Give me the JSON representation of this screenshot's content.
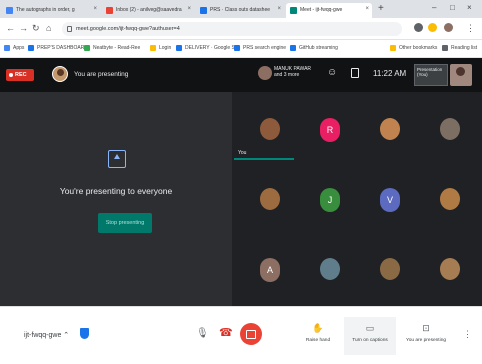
{
  "browser": {
    "tabs": [
      {
        "label": "The autographs in order, g",
        "fav": "#4285f4",
        "active": false
      },
      {
        "label": "Inbox (2) - anilveg@saavedra",
        "fav": "#ea4335",
        "active": false
      },
      {
        "label": "PRS · Class outs datashee",
        "fav": "#1a73e8",
        "active": false
      },
      {
        "label": "Meet - ijt-fwqq-gwe",
        "fav": "#00897b",
        "active": true
      }
    ],
    "new_tab": "+",
    "url": "meet.google.com/ijt-fwqq-gwe?authuser=4",
    "bookmarks": [
      {
        "label": "Apps",
        "fav": "#4285f4"
      },
      {
        "label": "PREP'S DASHBOARD",
        "fav": "#1a73e8"
      },
      {
        "label": "Neatbyte - Read-Ree",
        "fav": "#34a853"
      },
      {
        "label": "Login",
        "fav": "#fbbc04"
      },
      {
        "label": "DELIVERY · Google S",
        "fav": "#1a73e8"
      },
      {
        "label": "PRS search engine",
        "fav": "#1a73e8"
      },
      {
        "label": "GitHub streaming",
        "fav": "#1a73e8"
      },
      {
        "label": "Other bookmarks",
        "fav": "#fbbc04"
      },
      {
        "label": "Reading list",
        "fav": "#5f6368"
      }
    ]
  },
  "meet": {
    "rec_label": "REC",
    "presenting_label": "You are presenting",
    "host_label": "MANUK PAWAR and 3 more",
    "clock": "11:22 AM",
    "presentation_thumb_label": "Presentation (You)",
    "present_message": "You're presenting to everyone",
    "stop_button": "Stop presenting",
    "you_label": "You",
    "tiles": [
      {
        "letter": "",
        "color": "#8d5a3b",
        "photo": true
      },
      {
        "letter": "R",
        "color": "#e91e63",
        "photo": false
      },
      {
        "letter": "",
        "color": "#c0834f",
        "photo": true
      },
      {
        "letter": "",
        "color": "#7d6e63",
        "photo": true
      },
      {
        "letter": "",
        "color": "#9c6b3f",
        "photo": true
      },
      {
        "letter": "J",
        "color": "#388e3c",
        "photo": false
      },
      {
        "letter": "V",
        "color": "#5c6bc0",
        "photo": false
      },
      {
        "letter": "",
        "color": "#b07a45",
        "photo": true
      },
      {
        "letter": "A",
        "color": "#8d6e63",
        "photo": false
      },
      {
        "letter": "",
        "color": "#607d8b",
        "photo": true
      },
      {
        "letter": "",
        "color": "#8a6a45",
        "photo": true
      },
      {
        "letter": "",
        "color": "#a67c52",
        "photo": true
      }
    ]
  },
  "controls": {
    "meeting_code": "ijt-fwqq-gwe",
    "raise_hand": "Raise hand",
    "captions": "Turn on captions",
    "presenting": "You are presenting",
    "more": "⋮"
  }
}
